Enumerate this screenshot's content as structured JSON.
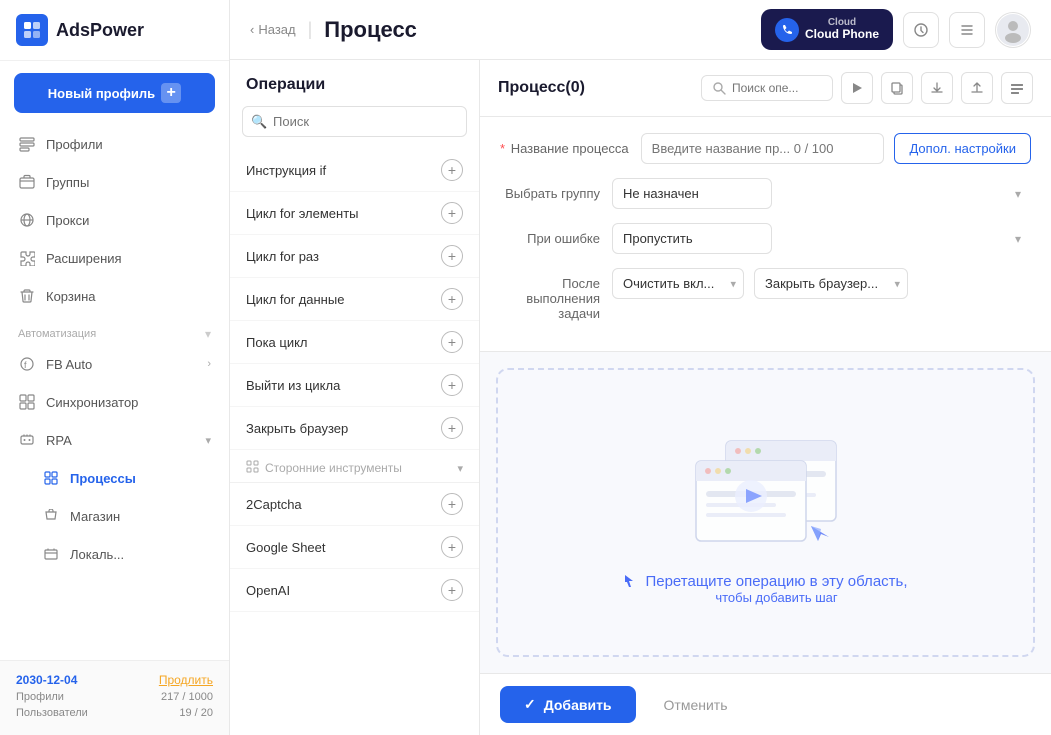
{
  "app": {
    "logo_text": "AdsPower",
    "logo_short": "A"
  },
  "sidebar": {
    "new_profile_btn": "Новый профиль",
    "nav_items": [
      {
        "id": "profiles",
        "label": "Профили",
        "icon": "🗂"
      },
      {
        "id": "groups",
        "label": "Группы",
        "icon": "📁"
      },
      {
        "id": "proxy",
        "label": "Прокси",
        "icon": "🔗"
      },
      {
        "id": "extensions",
        "label": "Расширения",
        "icon": "🔧"
      },
      {
        "id": "trash",
        "label": "Корзина",
        "icon": "🗑"
      }
    ],
    "automation_label": "Автоматизация",
    "automation_items": [
      {
        "id": "fb-auto",
        "label": "FB Auto",
        "icon": "◯",
        "has_chevron": true
      },
      {
        "id": "sync",
        "label": "Синхронизатор",
        "icon": "⊞"
      },
      {
        "id": "rpa",
        "label": "RPA",
        "icon": "⬡",
        "has_chevron": true
      }
    ],
    "rpa_sub_items": [
      {
        "id": "processes",
        "label": "Процессы",
        "active": true
      },
      {
        "id": "shop",
        "label": "Магазин"
      },
      {
        "id": "local",
        "label": "Локаль..."
      }
    ],
    "footer": {
      "date": "2030-12-04",
      "extend_label": "Продлить",
      "profiles_label": "Профили",
      "profiles_value": "217 / 1000",
      "users_label": "Пользователи",
      "users_value": "19 / 20"
    }
  },
  "topbar": {
    "back_label": "Назад",
    "page_title": "Процесс",
    "cloud_phone_label": "Cloud Phone",
    "cloud_phone_line2": ""
  },
  "operations": {
    "panel_title": "Операции",
    "search_placeholder": "Поиск",
    "items": [
      {
        "id": "if",
        "label": "Инструкция if"
      },
      {
        "id": "for-elem",
        "label": "Цикл for элементы"
      },
      {
        "id": "for-times",
        "label": "Цикл for раз"
      },
      {
        "id": "for-data",
        "label": "Цикл for данные"
      },
      {
        "id": "while",
        "label": "Пока цикл"
      },
      {
        "id": "break",
        "label": "Выйти из цикла"
      },
      {
        "id": "close-browser",
        "label": "Закрыть браузер"
      }
    ],
    "third_party_section": "Сторонние инструменты",
    "third_party_items": [
      {
        "id": "captcha",
        "label": "2Captcha"
      },
      {
        "id": "gsheet",
        "label": "Google Sheet"
      },
      {
        "id": "openai",
        "label": "OpenAI"
      }
    ]
  },
  "process": {
    "title": "Процесс(0)",
    "search_placeholder": "Поиск опе...",
    "name_label": "Название процесса",
    "name_required": true,
    "name_placeholder": "Введите название пр... 0 / 100",
    "extra_settings_label": "Допол. настройки",
    "group_label": "Выбрать группу",
    "group_value": "Не назначен",
    "error_label": "При ошибке",
    "error_value": "Пропустить",
    "after_label": "После выполнения задачи",
    "after_option1": "Очистить вкл...",
    "after_option2": "Закрыть браузер...",
    "drop_text": "Перетащите операцию в эту область,",
    "drop_subtext": "чтобы добавить шаг",
    "add_btn": "✓ Добавить",
    "cancel_btn": "Отменить"
  }
}
